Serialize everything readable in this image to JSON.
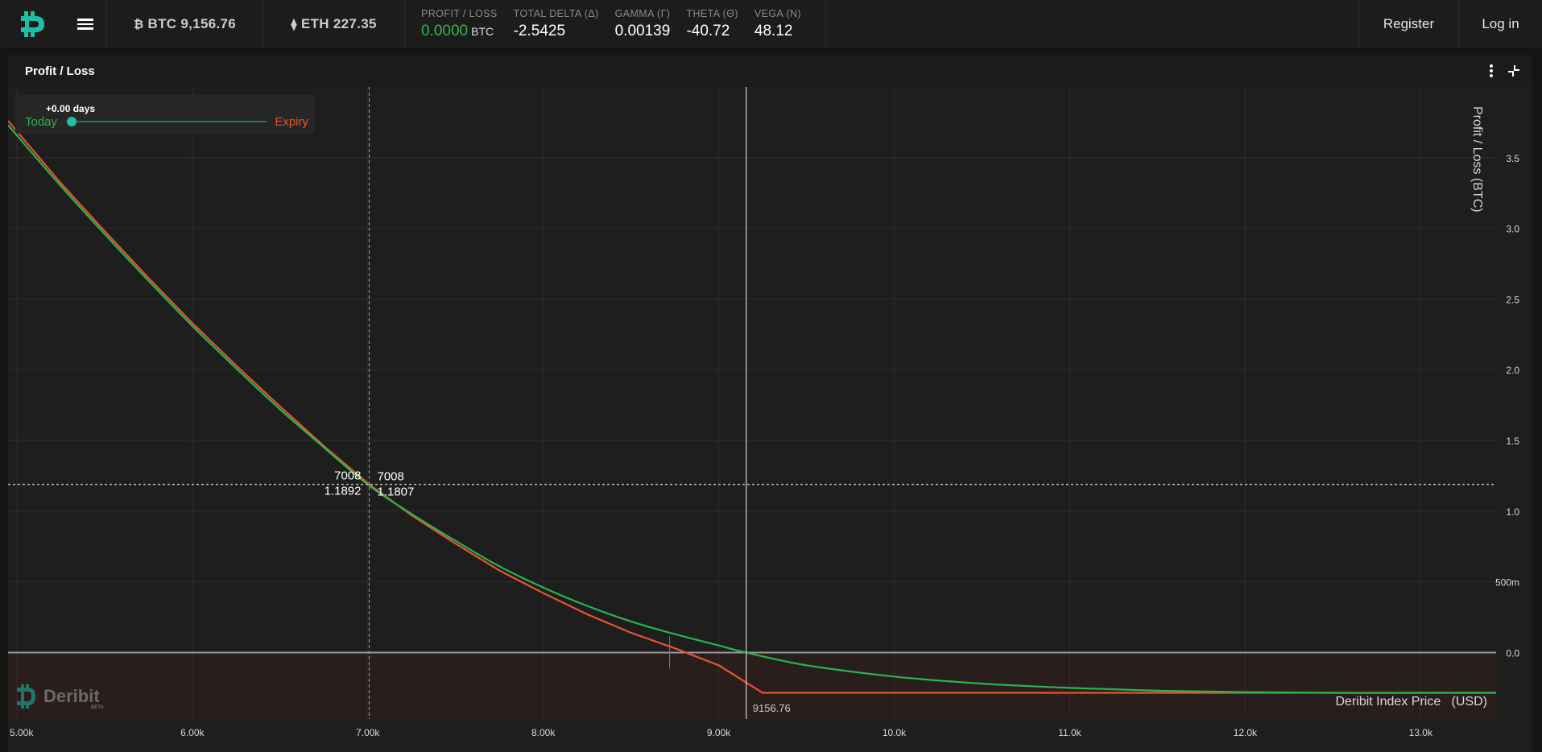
{
  "topbar": {
    "btc_label": "BTC 9,156.76",
    "eth_label": "ETH 227.35",
    "greeks": [
      {
        "label": "PROFIT / LOSS",
        "value": "0.0000",
        "unit": "BTC",
        "green": true
      },
      {
        "label": "TOTAL DELTA (Δ)",
        "value": "-2.5425",
        "unit": "",
        "green": false
      },
      {
        "label": "GAMMA (Γ)",
        "value": "0.00139",
        "unit": "",
        "green": false
      },
      {
        "label": "THETA (Θ)",
        "value": "-40.72",
        "unit": "",
        "green": false
      },
      {
        "label": "VEGA (N)",
        "value": "48.12",
        "unit": "",
        "green": false
      }
    ],
    "register_label": "Register",
    "login_label": "Log in"
  },
  "panel": {
    "title": "Profit / Loss"
  },
  "slider": {
    "days_label": "+0.00 days",
    "today_label": "Today",
    "expiry_label": "Expiry",
    "value": 0
  },
  "colors": {
    "today": "#27b450",
    "expiry": "#e8542b",
    "accent": "#1fbfa5"
  },
  "chart_data": {
    "type": "line",
    "ylabel": "Profit / Loss   (BTC)",
    "xlabel": "Deribit Index Price   (USD)",
    "xlim": [
      4950,
      13430
    ],
    "ylim": [
      -0.47,
      4.0
    ],
    "x_ticks": [
      {
        "v": 5000,
        "label": "5.00k"
      },
      {
        "v": 6000,
        "label": "6.00k"
      },
      {
        "v": 7000,
        "label": "7.00k"
      },
      {
        "v": 8000,
        "label": "8.00k"
      },
      {
        "v": 9000,
        "label": "9.00k"
      },
      {
        "v": 10000,
        "label": "10.0k"
      },
      {
        "v": 11000,
        "label": "11.0k"
      },
      {
        "v": 12000,
        "label": "12.0k"
      },
      {
        "v": 13000,
        "label": "13.0k"
      }
    ],
    "y_ticks": [
      {
        "v": 0,
        "label": "0.0"
      },
      {
        "v": 0.5,
        "label": "500m"
      },
      {
        "v": 1.0,
        "label": "1.0"
      },
      {
        "v": 1.5,
        "label": "1.5"
      },
      {
        "v": 2.0,
        "label": "2.0"
      },
      {
        "v": 2.5,
        "label": "2.5"
      },
      {
        "v": 3.0,
        "label": "3.0"
      },
      {
        "v": 3.5,
        "label": "3.5"
      }
    ],
    "series": [
      {
        "name": "Today",
        "x": [
          4950,
          5250,
          5500,
          5750,
          6000,
          6250,
          6500,
          6750,
          7008,
          7250,
          7500,
          7750,
          8000,
          8250,
          8500,
          8750,
          9000,
          9157,
          9500,
          10000,
          10500,
          11000,
          11500,
          12000,
          12500,
          13000,
          13430
        ],
        "y": [
          3.73,
          3.3,
          2.96,
          2.63,
          2.31,
          2.01,
          1.72,
          1.45,
          1.1807,
          0.98,
          0.79,
          0.61,
          0.46,
          0.33,
          0.22,
          0.13,
          0.05,
          0.0,
          -0.09,
          -0.17,
          -0.22,
          -0.25,
          -0.27,
          -0.28,
          -0.285,
          -0.285,
          -0.285
        ]
      },
      {
        "name": "Expiry",
        "x": [
          4950,
          5250,
          5500,
          5750,
          6000,
          6250,
          6500,
          6750,
          7008,
          7250,
          7500,
          7750,
          8000,
          8250,
          8500,
          8750,
          9000,
          9250,
          10000,
          11000,
          12000,
          13000,
          13430
        ],
        "y": [
          3.76,
          3.32,
          2.98,
          2.65,
          2.33,
          2.03,
          1.74,
          1.46,
          1.1892,
          0.97,
          0.77,
          0.58,
          0.42,
          0.27,
          0.14,
          0.03,
          -0.09,
          -0.285,
          -0.285,
          -0.285,
          -0.285,
          -0.285,
          -0.285
        ]
      }
    ],
    "crosshair": {
      "x": 7008,
      "y": 1.1892,
      "today_x_label": "7008",
      "today_y_label": "1.1807",
      "expiry_x_label": "7008",
      "expiry_y_label": "1.1892"
    },
    "index_price": {
      "value": 9156.76,
      "label": "9156.76"
    },
    "breakeven_expiry": 8720,
    "grid": true
  }
}
